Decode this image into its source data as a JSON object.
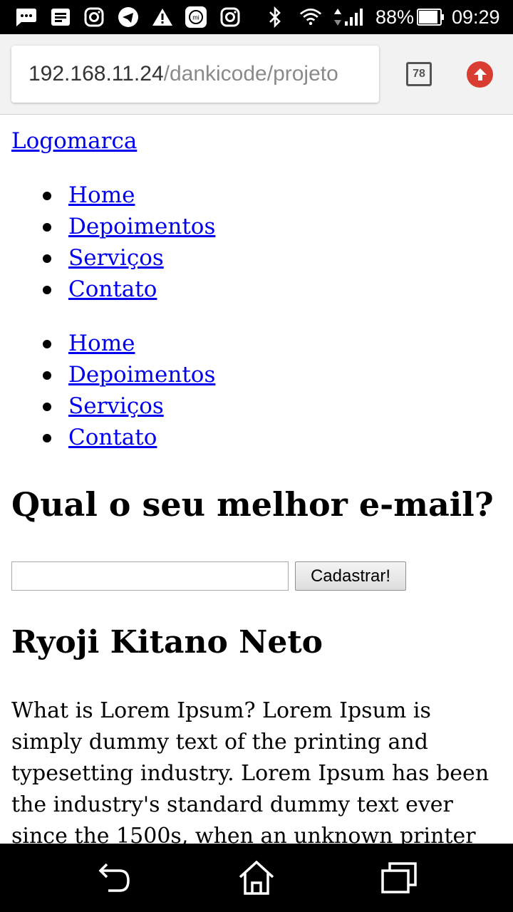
{
  "status_bar": {
    "icons": [
      "chat-icon",
      "news-icon",
      "instagram-icon",
      "telegram-icon",
      "warning-icon",
      "mi-icon",
      "instagram-icon",
      "bluetooth-icon",
      "wifi-icon",
      "signal-icon",
      "battery-icon"
    ],
    "mi_label": "mi",
    "battery": "88%",
    "time": "09:29"
  },
  "browser": {
    "url_host": "192.168.11.24",
    "url_path": "/dankicode/projeto",
    "tab_count": "78",
    "accent_color": "#d93d31"
  },
  "page": {
    "logo": "Logomarca",
    "nav_primary": [
      "Home",
      "Depoimentos",
      "Serviços",
      "Contato"
    ],
    "nav_secondary": [
      "Home",
      "Depoimentos",
      "Serviços",
      "Contato"
    ],
    "email_heading": "Qual o seu melhor e-mail?",
    "email_value": "",
    "submit_label": "Cadastrar!",
    "name_heading": "Ryoji Kitano Neto",
    "body_text": "What is Lorem Ipsum? Lorem Ipsum is simply dummy text of the printing and typesetting industry. Lorem Ipsum has been the industry's standard dummy text ever since the 1500s, when an unknown printer"
  },
  "nav_bar": {
    "buttons": [
      "back-icon",
      "home-icon",
      "recents-icon"
    ]
  }
}
